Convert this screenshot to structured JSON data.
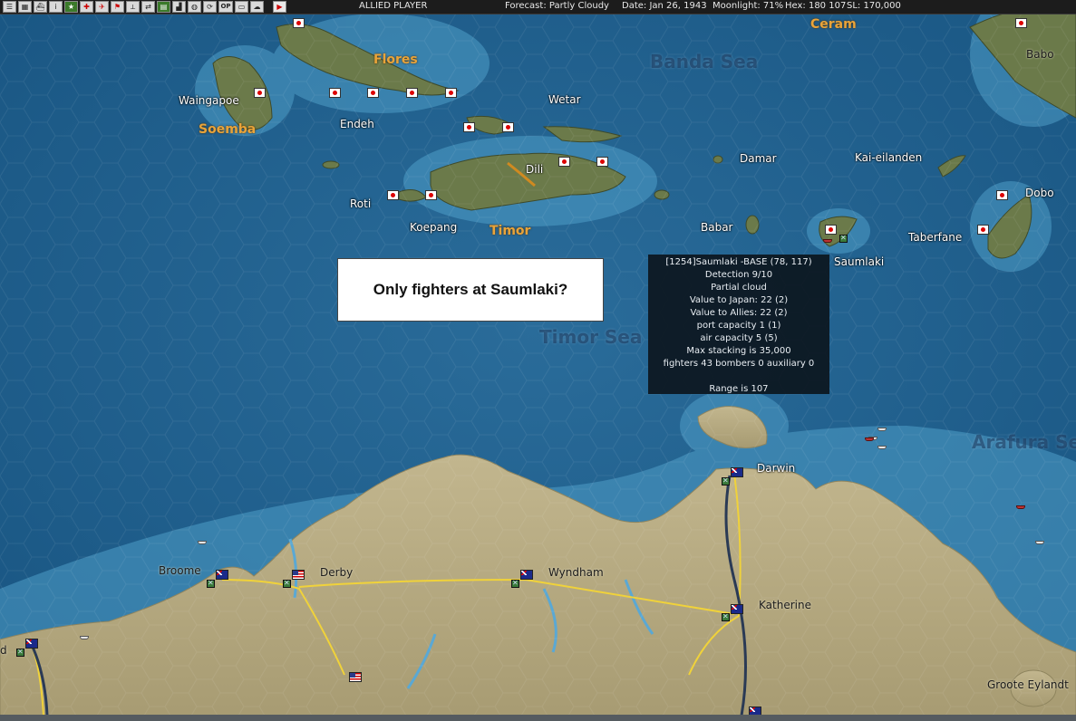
{
  "toolbar": {
    "buttons": [
      "list-icon",
      "grid-icon",
      "ship-icon",
      "info-icon",
      "star-icon",
      "cross-icon",
      "plane-icon",
      "flag-icon",
      "aircraft-icon",
      "transfer-icon",
      "document-icon",
      "factory-icon",
      "globe-icon",
      "cycle-icon",
      "op-button",
      "report-icon",
      "weather-icon",
      "play-icon"
    ],
    "op_label": "OP",
    "player": "ALLIED PLAYER",
    "forecast": "Forecast: Partly Cloudy",
    "date": "Date: Jan 26, 1943",
    "moonlight": "Moonlight: 71%",
    "hex": "Hex: 180  107",
    "sl": "SL: 170,000"
  },
  "map": {
    "regions": {
      "flores": "Flores",
      "soemba": "Soemba",
      "timor": "Timor",
      "ceram": "Ceram"
    },
    "seas": {
      "banda": "Banda Sea",
      "timor": "Timor Sea",
      "arafura": "Arafura Sea"
    },
    "places": {
      "waingapoe": "Waingapoe",
      "endeh": "Endeh",
      "wetar": "Wetar",
      "dili": "Dili",
      "roti": "Roti",
      "koepang": "Koepang",
      "damar": "Damar",
      "kai": "Kai-eilanden",
      "babo": "Babo",
      "dobo": "Dobo",
      "babar": "Babar",
      "saumlaki": "Saumlaki",
      "taberfane": "Taberfane",
      "darwin": "Darwin",
      "broome": "Broome",
      "derby": "Derby",
      "wyndham": "Wyndham",
      "katherine": "Katherine",
      "groote": "Groote Eylandt",
      "edge_d": "d"
    }
  },
  "question": "Only fighters at Saumlaki?",
  "tooltip": {
    "line1": "[1254]Saumlaki -BASE (78, 117)",
    "line2": "Detection 9/10",
    "line3": "Partial cloud",
    "line4": "Value to Japan: 22 (2)",
    "line5": "Value to Allies: 22 (2)",
    "line6": "port capacity 1 (1)",
    "line7": "air capacity 5 (5)",
    "line8": "Max stacking is 35,000",
    "line9": "fighters 43  bombers 0  auxiliary 0",
    "line10": "Range is 107"
  },
  "colors": {
    "sea": "#1f5f8f",
    "land": "#b8ad84",
    "region_label": "#e9a43a",
    "tooltip_bg": "#0c161e"
  }
}
